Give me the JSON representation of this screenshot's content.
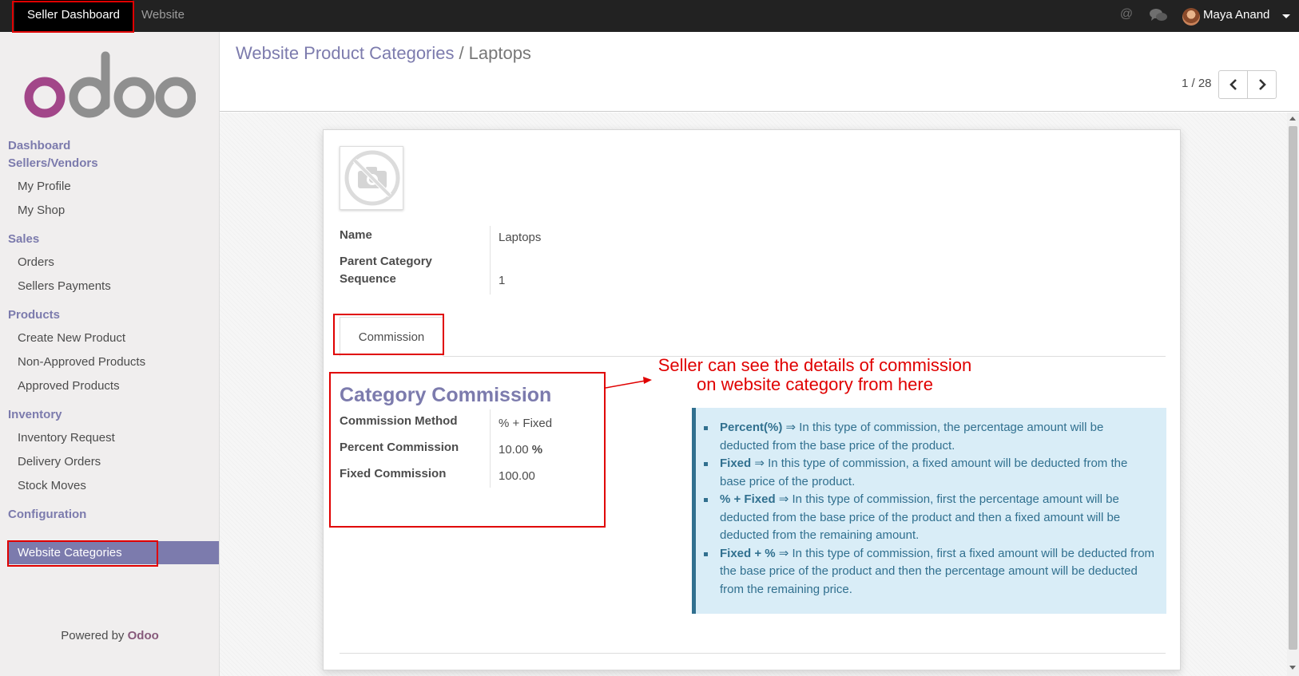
{
  "topbar": {
    "seller_dashboard": "Seller Dashboard",
    "website": "Website",
    "mention_icon": "at-icon",
    "chat_icon": "chat-bubbles-icon",
    "user_name": "Maya Anand"
  },
  "sidebar": {
    "sections": [
      {
        "title": "Dashboard",
        "items": []
      },
      {
        "title": "Sellers/Vendors",
        "items": [
          "My Profile",
          "My Shop"
        ]
      },
      {
        "title": "Sales",
        "items": [
          "Orders",
          "Sellers Payments"
        ]
      },
      {
        "title": "Products",
        "items": [
          "Create New Product",
          "Non-Approved Products",
          "Approved Products"
        ]
      },
      {
        "title": "Inventory",
        "items": [
          "Inventory Request",
          "Delivery Orders",
          "Stock Moves"
        ]
      },
      {
        "title": "Configuration",
        "items": [
          "Website Categories"
        ]
      }
    ],
    "active_item": "Website Categories",
    "powered_by": "Powered by",
    "powered_brand": "Odoo"
  },
  "control_panel": {
    "breadcrumb_parent": "Website Product Categories",
    "breadcrumb_separator": "/",
    "breadcrumb_current": "Laptops",
    "pager_value": "1 / 28"
  },
  "form": {
    "fields": {
      "name_label": "Name",
      "name_value": "Laptops",
      "parent_label": "Parent Category",
      "sequence_label": "Sequence",
      "sequence_value": "1"
    },
    "tab": "Commission",
    "commission": {
      "title": "Category Commission",
      "method_label": "Commission Method",
      "method_value": "% + Fixed",
      "percent_label": "Percent Commission",
      "percent_value": "10.00",
      "percent_unit": "%",
      "fixed_label": "Fixed Commission",
      "fixed_value": "100.00"
    },
    "info": [
      {
        "term": "Percent(%)",
        "text": " ⇒ In this type of commission, the percentage amount will be deducted from the base price of the product."
      },
      {
        "term": "Fixed",
        "text": " ⇒ In this type of commission, a fixed amount will be deducted from the base price of the product."
      },
      {
        "term": "% + Fixed",
        "text": " ⇒ In this type of commission, first the percentage amount will be deducted from the base price of the product and then a fixed amount will be deducted from the remaining amount."
      },
      {
        "term": "Fixed + %",
        "text": " ⇒ In this type of commission, first a fixed amount will be deducted from the base price of the product and then the percentage amount will be deducted from the remaining price."
      }
    ]
  },
  "annotation": {
    "line1": "Seller can see the details of commission",
    "line2": "on website category from here"
  },
  "colors": {
    "accent": "#7c7bad",
    "annotation_red": "#e00000",
    "info_bg": "#d9edf7",
    "info_text": "#31708f"
  }
}
